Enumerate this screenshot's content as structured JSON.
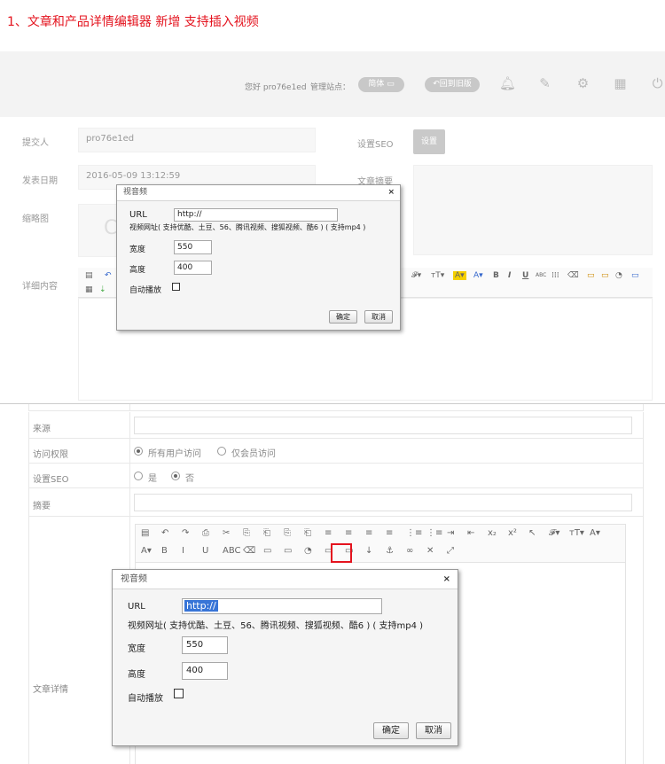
{
  "caption": "1、文章和产品详情编辑器 新增 支持插入视频",
  "header": {
    "greeting": "您好 pro76e1ed",
    "site_label": "管理站点：",
    "lang_button": "简体",
    "back_button": "回到旧版",
    "icons": [
      "bell-icon",
      "edit-icon",
      "gear-icon",
      "grid-icon",
      "power-icon"
    ]
  },
  "form1": {
    "submitter_label": "提交人",
    "submitter_value": "pro76e1ed",
    "date_label": "发表日期",
    "date_value": "2016-05-09 13:12:59",
    "thumb_label": "缩略图",
    "thumb_char": "C",
    "detail_label": "详细内容",
    "seo_label": "设置SEO",
    "seo_button": "设置",
    "summary_label": "文章摘要"
  },
  "dialog": {
    "title": "视音频",
    "close": "×",
    "url_label": "URL",
    "url_value": "http://",
    "hint": "视频网址( 支持优酷、土豆、56、腾讯视频、搜狐视频、酷6 ) ( 支持mp4 )",
    "width_label": "宽度",
    "width_value": "550",
    "height_label": "高度",
    "height_value": "400",
    "autoplay_label": "自动播放",
    "ok": "确定",
    "cancel": "取消"
  },
  "form2": {
    "source_label": "来源",
    "access_label": "访问权限",
    "access_all": "所有用户访问",
    "access_members": "仅会员访问",
    "seo_label": "设置SEO",
    "seo_yes": "是",
    "seo_no": "否",
    "summary_label": "摘要",
    "detail_label": "文章详情"
  },
  "toolbar_top_glyphs": [
    "𝓕▾",
    "тT▾",
    "A▾",
    "A▾",
    "B",
    "I",
    "U",
    "ABC",
    "⁞⁞⁞",
    "⌫"
  ],
  "toolbar2_row1": [
    "▤",
    "↶",
    "↷",
    "⎙",
    "✂",
    "⎘",
    "⎗",
    "⎘",
    "⎗",
    "≡",
    "≡",
    "≡",
    "≡",
    "⋮≡",
    "⋮≡",
    "⇥",
    "⇤",
    "x₂",
    "x²",
    "↖",
    "𝓕▾",
    "тT▾",
    "A▾"
  ],
  "toolbar2_row2": [
    "A▾",
    "B",
    "I",
    "U",
    "ABC",
    "⌫",
    "▭",
    "▭",
    "◔",
    "▭",
    "▭",
    "↓",
    "⚓",
    "∞",
    "✕",
    "⤢"
  ],
  "accent": "#e4131e"
}
